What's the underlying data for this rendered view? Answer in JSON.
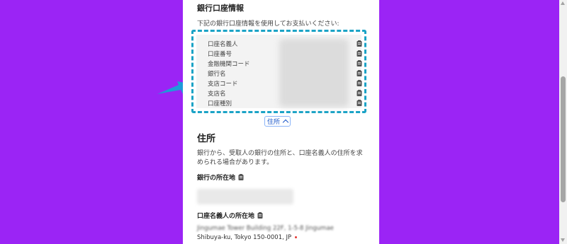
{
  "colors": {
    "background": "#9b24f5",
    "panel": "#ffffff",
    "highlight_border": "#1ba3c6",
    "arrow": "#1e9bd8",
    "link": "#1a56c8"
  },
  "bank": {
    "title": "銀行口座情報",
    "instruction": "下記の銀行口座情報を使用してお支払いください:",
    "fields": [
      {
        "label": "口座名義人"
      },
      {
        "label": "口座番号"
      },
      {
        "label": "金融機関コード"
      },
      {
        "label": "銀行名"
      },
      {
        "label": "支店コード"
      },
      {
        "label": "支店名"
      },
      {
        "label": "口座種別"
      }
    ],
    "copy_icon": "clipboard-icon"
  },
  "address_toggle": {
    "label": "住所",
    "icon": "chevron-up-icon"
  },
  "address": {
    "heading": "住所",
    "description": "銀行から、受取人の銀行の住所と、口座名義人の住所を求められる場合があります。",
    "bank_location_label": "銀行の所在地",
    "holder_location_label": "口座名義人の所在地",
    "holder_address_line1": "Jingumae Tower Building 22F, 1-5-8 Jingumae",
    "holder_address_line2": "Shibuya-ku, Tokyo 150-0001, JP"
  }
}
